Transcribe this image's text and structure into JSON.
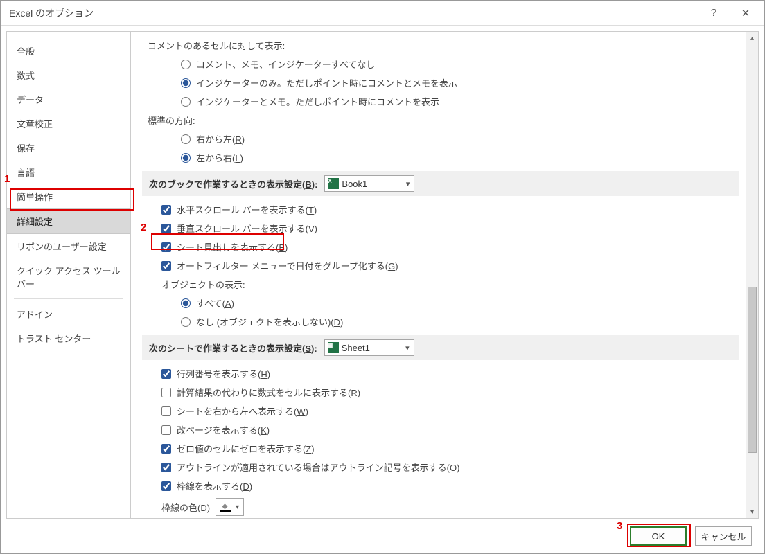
{
  "title": "Excel のオプション",
  "sidebar": {
    "items": [
      {
        "label": "全般"
      },
      {
        "label": "数式"
      },
      {
        "label": "データ"
      },
      {
        "label": "文章校正"
      },
      {
        "label": "保存"
      },
      {
        "label": "言語"
      },
      {
        "label": "簡単操作"
      },
      {
        "label": "詳細設定",
        "selected": true
      },
      {
        "label": "リボンのユーザー設定"
      },
      {
        "label": "クイック アクセス ツール バー"
      },
      {
        "label": "アドイン"
      },
      {
        "label": "トラスト センター"
      }
    ]
  },
  "main": {
    "commentCells": {
      "heading": "コメントのあるセルに対して表示:",
      "opts": [
        {
          "label": "コメント、メモ、インジケーターすべてなし",
          "checked": false
        },
        {
          "label": "インジケーターのみ。ただしポイント時にコメントとメモを表示",
          "checked": true
        },
        {
          "label": "インジケーターとメモ。ただしポイント時にコメントを表示",
          "checked": false
        }
      ]
    },
    "direction": {
      "heading": "標準の方向:",
      "opts": [
        {
          "label": "右から左(",
          "u": "R",
          "tail": ")",
          "checked": false
        },
        {
          "label": "左から右(",
          "u": "L",
          "tail": ")",
          "checked": true
        }
      ]
    },
    "book": {
      "heading": "次のブックで作業するときの表示設定(",
      "u": "B",
      "tail": "):",
      "value": "Book1",
      "checks": [
        {
          "label": "水平スクロール バーを表示する(",
          "u": "T",
          "tail": ")",
          "checked": true
        },
        {
          "label": "垂直スクロール バーを表示する(",
          "u": "V",
          "tail": ")",
          "checked": true
        },
        {
          "label": "シート見出しを表示する(",
          "u": "B",
          "tail": ")",
          "checked": true
        },
        {
          "label": "オートフィルター メニューで日付をグループ化する(",
          "u": "G",
          "tail": ")",
          "checked": true
        }
      ],
      "objects": {
        "heading": "オブジェクトの表示:",
        "opts": [
          {
            "label": "すべて(",
            "u": "A",
            "tail": ")",
            "checked": true
          },
          {
            "label": "なし (オブジェクトを表示しない)(",
            "u": "D",
            "tail": ")",
            "checked": false
          }
        ]
      }
    },
    "sheet": {
      "heading": "次のシートで作業するときの表示設定(",
      "u": "S",
      "tail": "):",
      "value": "Sheet1",
      "checks": [
        {
          "label": "行列番号を表示する(",
          "u": "H",
          "tail": ")",
          "checked": true
        },
        {
          "label": "計算結果の代わりに数式をセルに表示する(",
          "u": "R",
          "tail": ")",
          "checked": false
        },
        {
          "label": "シートを右から左へ表示する(",
          "u": "W",
          "tail": ")",
          "checked": false
        },
        {
          "label": "改ページを表示する(",
          "u": "K",
          "tail": ")",
          "checked": false
        },
        {
          "label": "ゼロ値のセルにゼロを表示する(",
          "u": "Z",
          "tail": ")",
          "checked": true
        },
        {
          "label": "アウトラインが適用されている場合はアウトライン記号を表示する(",
          "u": "O",
          "tail": ")",
          "checked": true
        },
        {
          "label": "枠線を表示する(",
          "u": "D",
          "tail": ")",
          "checked": true
        }
      ],
      "gridcolor": {
        "label": "枠線の色(",
        "u": "D",
        "tail": ")"
      }
    }
  },
  "footer": {
    "ok": "OK",
    "cancel": "キャンセル"
  },
  "annot": {
    "a1": "1",
    "a2": "2",
    "a3": "3"
  }
}
